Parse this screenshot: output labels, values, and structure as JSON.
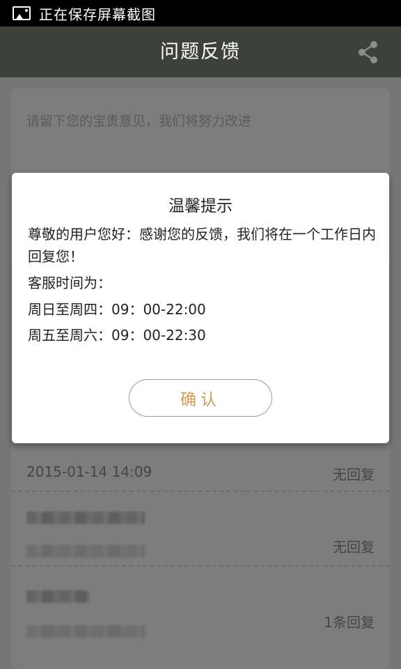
{
  "status_bar": {
    "text": "正在保存屏幕截图",
    "icon": "image-icon"
  },
  "header": {
    "title": "问题反馈",
    "share_icon": "share-icon"
  },
  "feedback_input": {
    "placeholder": "请留下您的宝贵意见，我们将努力改进"
  },
  "history": [
    {
      "date": "2015-01-14 14:09",
      "reply": "无回复"
    },
    {
      "date": "",
      "reply": "无回复"
    },
    {
      "date": "",
      "reply": "1条回复"
    }
  ],
  "dialog": {
    "title": "温馨提示",
    "message": "尊敬的用户您好：感谢您的反馈，我们将在一个工作日内回复您！",
    "hours_label": "客服时间为：",
    "hours_weekday": "周日至周四：09：00-22:00",
    "hours_weekend": "周五至周六：09：00-22:30",
    "confirm_label": "确认"
  },
  "colors": {
    "header_bg": "#3e4139",
    "confirm_text": "#d19a55",
    "overlay": "rgba(0,0,0,0.5)"
  }
}
